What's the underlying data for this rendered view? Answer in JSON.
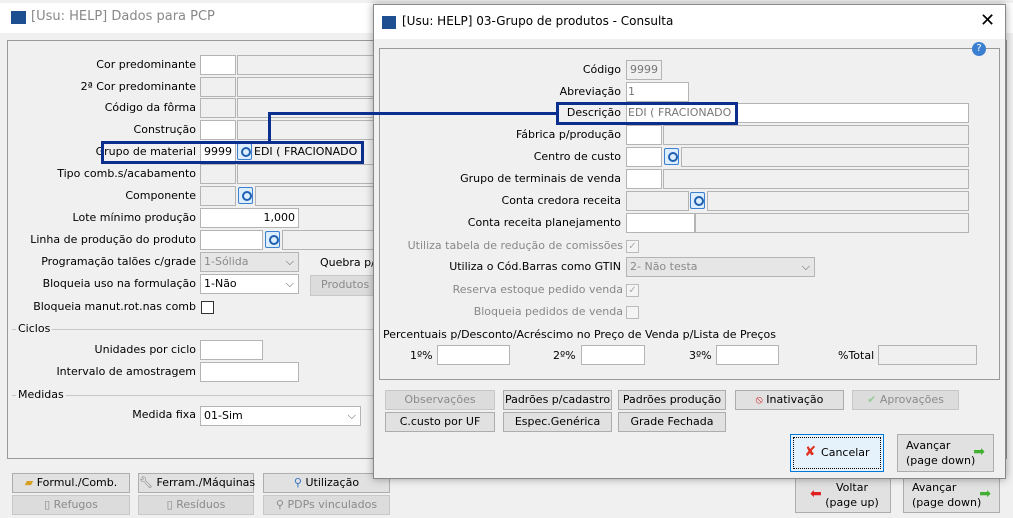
{
  "main": {
    "title": "[Usu: HELP] Dados para PCP",
    "fields": {
      "cor": "Cor predominante",
      "cor2": "2ª Cor predominante",
      "forma": "Código da fôrma",
      "construcao": "Construção",
      "grupo": "Grupo de material",
      "grupo_code": "9999",
      "grupo_desc": "EDI ( FRACIONADO )",
      "tipo": "Tipo comb.s/acabamento",
      "componente": "Componente",
      "lote": "Lote mínimo produção",
      "lote_value": "1,000",
      "linha": "Linha de produção do produto",
      "programacao": "Programação talões c/grade",
      "programacao_value": "1-Sólida",
      "quebra": "Quebra p/t",
      "bloqueia_uso": "Bloqueia uso na formulação",
      "bloqueia_uso_value": "1-Não",
      "produtos": "Produtos li",
      "bloqueia_manut": "Bloqueia manut.rot.nas comb"
    },
    "ciclos": {
      "title": "Ciclos",
      "unidades": "Unidades por ciclo",
      "intervalo": "Intervalo de amostragem"
    },
    "medidas": {
      "title": "Medidas",
      "medida_fixa": "Medida fixa",
      "medida_fixa_value": "01-Sim"
    },
    "buttons": {
      "formul": "Formul./Comb.",
      "ferram": "Ferram./Máquinas",
      "utilizacao": "Utilização",
      "refugos": "Refugos",
      "residuos": "Resíduos",
      "pdps": "PDPs vinculados",
      "voltar": "Voltar",
      "voltar2": "(page up)",
      "avancar": "Avançar",
      "avancar2": "(page down)"
    }
  },
  "dialog": {
    "title": "[Usu: HELP] 03-Grupo de produtos - Consulta",
    "fields": {
      "codigo": "Código",
      "codigo_value": "9999",
      "abreviacao": "Abreviação",
      "abreviacao_value": "1",
      "descricao": "Descrição",
      "descricao_value": "EDI ( FRACIONADO )",
      "fabrica": "Fábrica p/produção",
      "centro": "Centro de custo",
      "grupo_term": "Grupo de terminais de venda",
      "conta_credora": "Conta credora receita",
      "conta_plan": "Conta receita planejamento",
      "utiliza_tabela": "Utiliza tabela de redução de comissões",
      "gtin": "Utiliza o Cód.Barras como GTIN",
      "gtin_value": "2- Não testa",
      "reserva": "Reserva estoque pedido venda",
      "bloqueia_ped": "Bloqueia pedidos de venda"
    },
    "percentuais": {
      "title": "Percentuais p/Desconto/Acréscimo no Preço de Venda p/Lista de Preços",
      "p1": "1º%",
      "p2": "2º%",
      "p3": "3º%",
      "total": "%Total"
    },
    "buttons": {
      "observacoes": "Observações",
      "padroes_cad": "Padrões p/cadastro",
      "padroes_prod": "Padrões produção",
      "inativacao": "Inativação",
      "aprovacoes": "Aprovações",
      "ccusto_uf": "C.custo por UF",
      "espec": "Espec.Genérica",
      "grade": "Grade Fechada",
      "cancelar": "Cancelar",
      "avancar": "Avançar",
      "avancar2": "(page down)"
    }
  },
  "colors": {
    "highlight": "#0a2f8f"
  }
}
